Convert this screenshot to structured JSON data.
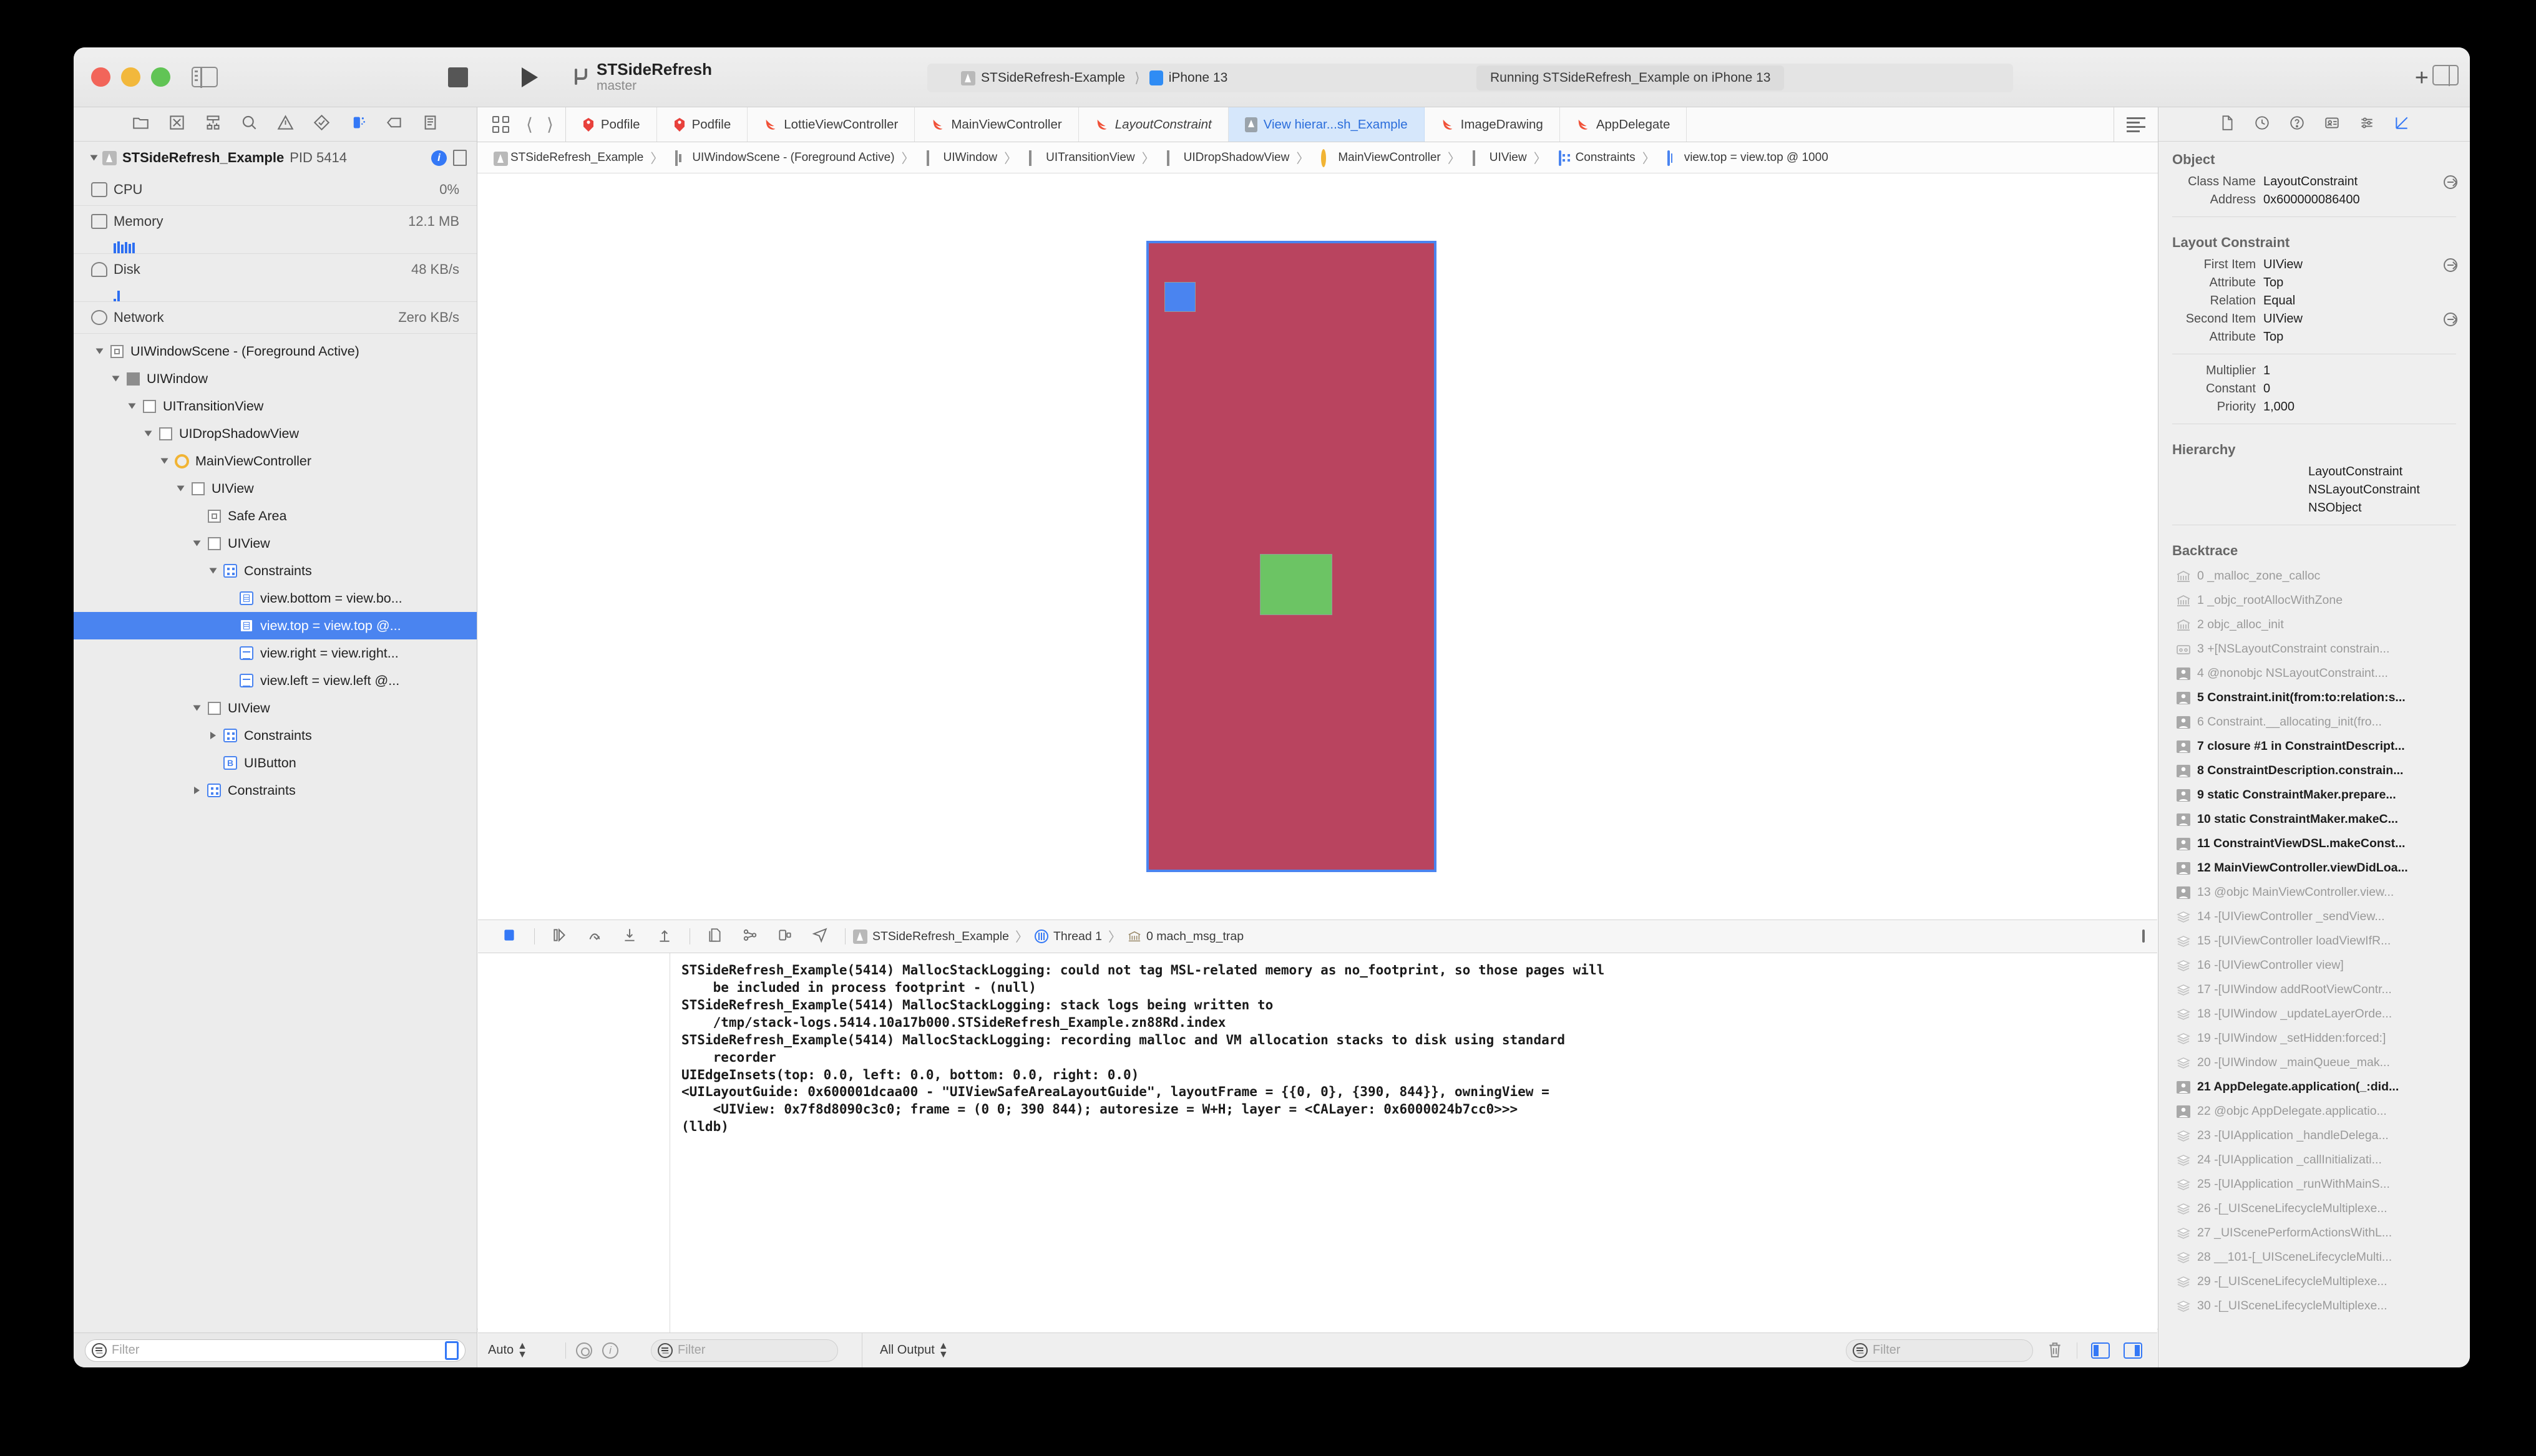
{
  "window": {
    "project_name": "STSideRefresh",
    "branch": "master",
    "scheme": "STSideRefresh-Example",
    "destination": "iPhone 13",
    "status": "Running STSideRefresh_Example on iPhone 13"
  },
  "navigator": {
    "toolbar_icons": [
      "folder-icon",
      "source-control-icon",
      "symbol-icon",
      "find-icon",
      "issue-icon",
      "test-icon",
      "debug-icon",
      "breakpoint-icon",
      "report-icon"
    ],
    "process": {
      "name": "STSideRefresh_Example",
      "pid": "PID 5414"
    },
    "gauges": [
      {
        "name": "CPU",
        "value": "0%"
      },
      {
        "name": "Memory",
        "value": "12.1 MB"
      },
      {
        "name": "Disk",
        "value": "48 KB/s"
      },
      {
        "name": "Network",
        "value": "Zero KB/s"
      }
    ],
    "tree": [
      {
        "label": "UIWindowScene - (Foreground Active)",
        "depth": 0,
        "twisty": "open",
        "icon": "scene-icon"
      },
      {
        "label": "UIWindow",
        "depth": 1,
        "twisty": "open",
        "icon": "window-icon"
      },
      {
        "label": "UITransitionView",
        "depth": 2,
        "twisty": "open",
        "icon": "view-icon"
      },
      {
        "label": "UIDropShadowView",
        "depth": 3,
        "twisty": "open",
        "icon": "view-icon"
      },
      {
        "label": "MainViewController",
        "depth": 4,
        "twisty": "open",
        "icon": "viewcontroller-icon"
      },
      {
        "label": "UIView",
        "depth": 5,
        "twisty": "open",
        "icon": "view-icon"
      },
      {
        "label": "Safe Area",
        "depth": 6,
        "twisty": "none",
        "icon": "safearea-icon"
      },
      {
        "label": "UIView",
        "depth": 6,
        "twisty": "open",
        "icon": "view-icon"
      },
      {
        "label": "Constraints",
        "depth": 7,
        "twisty": "open",
        "icon": "constraints-icon"
      },
      {
        "label": "view.bottom = view.bo...",
        "depth": 8,
        "twisty": "none",
        "icon": "constraint-bottom-icon"
      },
      {
        "label": "view.top = view.top @...",
        "depth": 8,
        "twisty": "none",
        "icon": "constraint-top-icon",
        "selected": true
      },
      {
        "label": "view.right = view.right...",
        "depth": 8,
        "twisty": "none",
        "icon": "constraint-right-icon"
      },
      {
        "label": "view.left = view.left @...",
        "depth": 8,
        "twisty": "none",
        "icon": "constraint-left-icon"
      },
      {
        "label": "UIView",
        "depth": 6,
        "twisty": "open",
        "icon": "view-icon"
      },
      {
        "label": "Constraints",
        "depth": 7,
        "twisty": "closed",
        "icon": "constraints-icon"
      },
      {
        "label": "UIButton",
        "depth": 7,
        "twisty": "none",
        "icon": "button-icon"
      },
      {
        "label": "Constraints",
        "depth": 6,
        "twisty": "closed",
        "icon": "constraints-icon"
      }
    ],
    "filter_placeholder": "Filter"
  },
  "editor": {
    "tabs": [
      {
        "label": "Podfile",
        "icon": "podfile-icon"
      },
      {
        "label": "Podfile",
        "icon": "podfile-icon"
      },
      {
        "label": "LottieViewController",
        "icon": "swift-icon"
      },
      {
        "label": "MainViewController",
        "icon": "swift-icon"
      },
      {
        "label": "LayoutConstraint",
        "icon": "swift-icon",
        "italic": true
      },
      {
        "label": "View hierar...sh_Example",
        "icon": "viewdebug-icon",
        "active": true
      },
      {
        "label": "ImageDrawing",
        "icon": "swift-icon"
      },
      {
        "label": "AppDelegate",
        "icon": "swift-icon"
      }
    ],
    "breadcrumbs": [
      {
        "label": "STSideRefresh_Example",
        "icon": "app-icon"
      },
      {
        "label": "UIWindowScene - (Foreground Active)",
        "icon": "scene-icon"
      },
      {
        "label": "UIWindow",
        "icon": "window-icon"
      },
      {
        "label": "UITransitionView",
        "icon": "view-icon"
      },
      {
        "label": "UIDropShadowView",
        "icon": "view-icon"
      },
      {
        "label": "MainViewController",
        "icon": "viewcontroller-icon"
      },
      {
        "label": "UIView",
        "icon": "view-icon"
      },
      {
        "label": "Constraints",
        "icon": "constraints-icon"
      },
      {
        "label": "view.top = view.top @ 1000",
        "icon": "constraint-top-icon"
      }
    ]
  },
  "canvas": {
    "root_view_color": "#b9445f",
    "selection_color": "#4a84f0",
    "blue_subview_color": "#4a84f0",
    "green_subview_color": "#6cc464",
    "toolbar_icons": [
      "show-clipped-content-icon",
      "show-constraints-icon",
      "view-mode-icon",
      "wireframe-icon",
      "3d-icon",
      "zoom-out-icon",
      "zoom-actual-icon",
      "zoom-in-icon"
    ]
  },
  "debug_bar": {
    "icons": [
      "continue-icon",
      "step-over-icon",
      "step-into-icon",
      "step-out-icon",
      "view-debug-icon",
      "memory-graph-icon",
      "simulate-location-icon",
      "view-hierarchy-icon"
    ],
    "crumbs": [
      {
        "label": "STSideRefresh_Example",
        "icon": "app-icon"
      },
      {
        "label": "Thread 1",
        "icon": "thread-icon"
      },
      {
        "label": "0 mach_msg_trap",
        "icon": "frame-icon"
      }
    ]
  },
  "console": {
    "text": "STSideRefresh_Example(5414) MallocStackLogging: could not tag MSL-related memory as no_footprint, so those pages will\n    be included in process footprint - (null)\nSTSideRefresh_Example(5414) MallocStackLogging: stack logs being written to\n    /tmp/stack-logs.5414.10a17b000.STSideRefresh_Example.zn88Rd.index\nSTSideRefresh_Example(5414) MallocStackLogging: recording malloc and VM allocation stacks to disk using standard\n    recorder\nUIEdgeInsets(top: 0.0, left: 0.0, bottom: 0.0, right: 0.0)\n<UILayoutGuide: 0x600001dcaa00 - \"UIViewSafeAreaLayoutGuide\", layoutFrame = {{0, 0}, {390, 844}}, owningView =\n    <UIView: 0x7f8d8090c3c0; frame = (0 0; 390 844); autoresize = W+H; layer = <CALayer: 0x6000024b7cc0>>>",
    "prompt": "(lldb)",
    "status": {
      "auto_label": "Auto",
      "filter_placeholder": "Filter",
      "output_label": "All Output",
      "console_filter_placeholder": "Filter"
    }
  },
  "inspector": {
    "tab_icons": [
      "file-inspector-icon",
      "history-icon",
      "quick-help-icon",
      "identity-icon",
      "attributes-icon",
      "size-inspector-icon"
    ],
    "sections": [
      {
        "title": "Object",
        "rows": [
          {
            "key": "Class Name",
            "value": "LayoutConstraint",
            "arrow": true
          },
          {
            "key": "Address",
            "value": "0x600000086400",
            "arrow": false
          }
        ]
      },
      {
        "title": "Layout Constraint",
        "rows": [
          {
            "key": "First Item",
            "value": "UIView",
            "arrow": true
          },
          {
            "key": "Attribute",
            "value": "Top",
            "arrow": false
          },
          {
            "key": "Relation",
            "value": "Equal",
            "arrow": false
          },
          {
            "key": "Second Item",
            "value": "UIView",
            "arrow": true
          },
          {
            "key": "Attribute",
            "value": "Top",
            "arrow": false
          }
        ]
      },
      {
        "title": "",
        "rows": [
          {
            "key": "Multiplier",
            "value": "1",
            "arrow": false
          },
          {
            "key": "Constant",
            "value": "0",
            "arrow": false
          },
          {
            "key": "Priority",
            "value": "1,000",
            "arrow": false
          }
        ]
      }
    ],
    "hierarchy_title": "Hierarchy",
    "hierarchy": [
      "LayoutConstraint",
      "NSLayoutConstraint",
      "NSObject"
    ],
    "backtrace_title": "Backtrace",
    "backtrace": [
      {
        "index": "0",
        "label": "_malloc_zone_calloc",
        "style": "dim",
        "icon": "system-lib-icon"
      },
      {
        "index": "1",
        "label": "_objc_rootAllocWithZone",
        "style": "dim",
        "icon": "system-lib-icon"
      },
      {
        "index": "2",
        "label": "objc_alloc_init",
        "style": "dim",
        "icon": "system-lib-icon"
      },
      {
        "index": "3",
        "label": "+[NSLayoutConstraint constrain...",
        "style": "dim",
        "icon": "framework-icon"
      },
      {
        "index": "4",
        "label": "@nonobjc NSLayoutConstraint....",
        "style": "dim",
        "icon": "user-code-icon"
      },
      {
        "index": "5",
        "label": "Constraint.init(from:to:relation:s...",
        "style": "bold",
        "icon": "user-code-icon"
      },
      {
        "index": "6",
        "label": "Constraint.__allocating_init(fro...",
        "style": "dim",
        "icon": "user-code-icon"
      },
      {
        "index": "7",
        "label": "closure #1 in ConstraintDescript...",
        "style": "bold",
        "icon": "user-code-icon"
      },
      {
        "index": "8",
        "label": "ConstraintDescription.constrain...",
        "style": "bold",
        "icon": "user-code-icon"
      },
      {
        "index": "9",
        "label": "static ConstraintMaker.prepare...",
        "style": "bold",
        "icon": "user-code-icon"
      },
      {
        "index": "10",
        "label": "static ConstraintMaker.makeC...",
        "style": "bold",
        "icon": "user-code-icon"
      },
      {
        "index": "11",
        "label": "ConstraintViewDSL.makeConst...",
        "style": "bold",
        "icon": "user-code-icon"
      },
      {
        "index": "12",
        "label": "MainViewController.viewDidLoa...",
        "style": "bold",
        "icon": "user-code-icon"
      },
      {
        "index": "13",
        "label": "@objc MainViewController.view...",
        "style": "dim",
        "icon": "user-code-icon"
      },
      {
        "index": "14",
        "label": "-[UIViewController _sendView...",
        "style": "dim",
        "icon": "uikit-icon"
      },
      {
        "index": "15",
        "label": "-[UIViewController loadViewIfR...",
        "style": "dim",
        "icon": "uikit-icon"
      },
      {
        "index": "16",
        "label": "-[UIViewController view]",
        "style": "dim",
        "icon": "uikit-icon"
      },
      {
        "index": "17",
        "label": "-[UIWindow addRootViewContr...",
        "style": "dim",
        "icon": "uikit-icon"
      },
      {
        "index": "18",
        "label": "-[UIWindow _updateLayerOrde...",
        "style": "dim",
        "icon": "uikit-icon"
      },
      {
        "index": "19",
        "label": "-[UIWindow _setHidden:forced:]",
        "style": "dim",
        "icon": "uikit-icon"
      },
      {
        "index": "20",
        "label": "-[UIWindow _mainQueue_mak...",
        "style": "dim",
        "icon": "uikit-icon"
      },
      {
        "index": "21",
        "label": "AppDelegate.application(_:did...",
        "style": "bold",
        "icon": "user-code-icon"
      },
      {
        "index": "22",
        "label": "@objc AppDelegate.applicatio...",
        "style": "dim",
        "icon": "user-code-icon"
      },
      {
        "index": "23",
        "label": "-[UIApplication _handleDelega...",
        "style": "dim",
        "icon": "uikit-icon"
      },
      {
        "index": "24",
        "label": "-[UIApplication _callInitializati...",
        "style": "dim",
        "icon": "uikit-icon"
      },
      {
        "index": "25",
        "label": "-[UIApplication _runWithMainS...",
        "style": "dim",
        "icon": "uikit-icon"
      },
      {
        "index": "26",
        "label": "-[_UISceneLifecycleMultiplexe...",
        "style": "dim",
        "icon": "uikit-icon"
      },
      {
        "index": "27",
        "label": "_UIScenePerformActionsWithL...",
        "style": "dim",
        "icon": "uikit-icon"
      },
      {
        "index": "28",
        "label": "__101-[_UISceneLifecycleMulti...",
        "style": "dim",
        "icon": "uikit-icon"
      },
      {
        "index": "29",
        "label": "-[_UISceneLifecycleMultiplexe...",
        "style": "dim",
        "icon": "uikit-icon"
      },
      {
        "index": "30",
        "label": "-[_UISceneLifecycleMultiplexe...",
        "style": "dim",
        "icon": "uikit-icon"
      }
    ]
  }
}
